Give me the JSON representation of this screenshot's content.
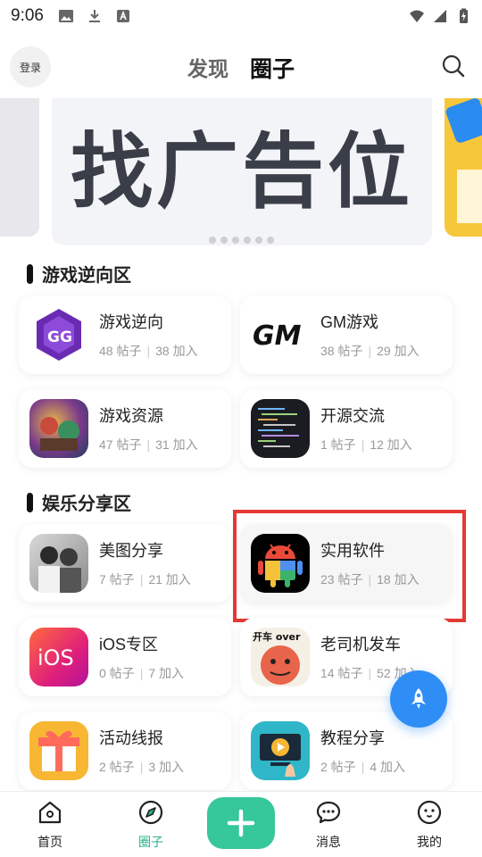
{
  "status_bar": {
    "time": "9:06"
  },
  "header": {
    "login_label": "登录",
    "tabs": [
      {
        "label": "发现"
      },
      {
        "label": "圈子"
      }
    ],
    "active_tab": "圈子"
  },
  "banner": {
    "text": "找广告位",
    "dot_count": 6
  },
  "sections": [
    {
      "title": "游戏逆向区",
      "cards": [
        {
          "name": "游戏逆向",
          "posts": "48 帖子",
          "joins": "38 加入",
          "icon": "gameguardian-icon"
        },
        {
          "name": "GM游戏",
          "posts": "38 帖子",
          "joins": "29 加入",
          "icon": "gm-logo-icon"
        },
        {
          "name": "游戏资源",
          "posts": "47 帖子",
          "joins": "31 加入",
          "icon": "game-art-icon"
        },
        {
          "name": "开源交流",
          "posts": "1 帖子",
          "joins": "12 加入",
          "icon": "code-terminal-icon"
        }
      ]
    },
    {
      "title": "娱乐分享区",
      "cards": [
        {
          "name": "美图分享",
          "posts": "7 帖子",
          "joins": "21 加入",
          "icon": "photo-icon"
        },
        {
          "name": "实用软件",
          "posts": "23 帖子",
          "joins": "18 加入",
          "icon": "android-icon"
        },
        {
          "name": "iOS专区",
          "posts": "0 帖子",
          "joins": "7 加入",
          "icon": "ios-icon",
          "icon_text": "iOS"
        },
        {
          "name": "老司机发车",
          "posts": "14 帖子",
          "joins": "52 加入",
          "icon": "meme-driver-icon",
          "icon_text": "开车 over"
        },
        {
          "name": "活动线报",
          "posts": "2 帖子",
          "joins": "3 加入",
          "icon": "gift-icon"
        },
        {
          "name": "教程分享",
          "posts": "2 帖子",
          "joins": "4 加入",
          "icon": "tutorial-video-icon"
        }
      ]
    }
  ],
  "bottom_nav": {
    "items": [
      {
        "label": "首页",
        "icon": "home-icon"
      },
      {
        "label": "圈子",
        "icon": "compass-icon",
        "active": true
      },
      {
        "label": "消息",
        "icon": "chat-icon"
      },
      {
        "label": "我的",
        "icon": "profile-icon"
      }
    ]
  },
  "colors": {
    "accent": "#36c79b",
    "active_nav": "#26b28a",
    "fab": "#2f8ef5",
    "highlight_border": "#e53935"
  }
}
